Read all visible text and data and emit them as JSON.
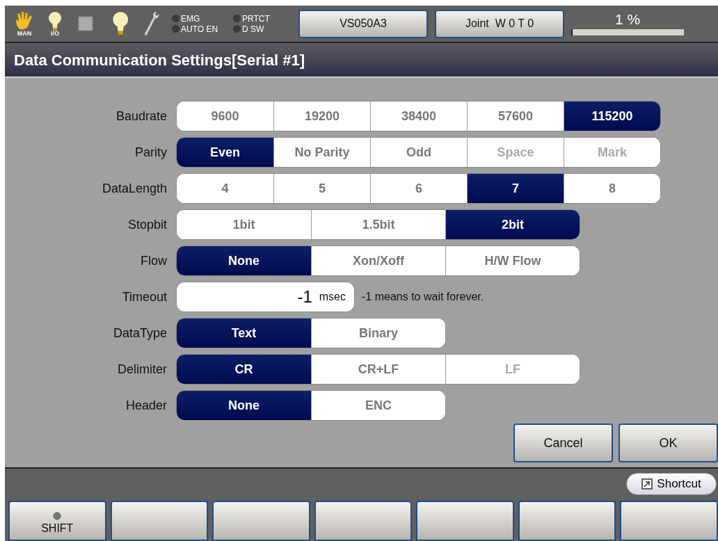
{
  "top_bar": {
    "mode_label": "MAN",
    "io_label": "I/O",
    "indicators": [
      {
        "label": "EMG",
        "on": false
      },
      {
        "label": "PRTCT",
        "on": false
      },
      {
        "label": "AUTO EN",
        "on": false
      },
      {
        "label": "D SW",
        "on": false
      }
    ],
    "buttons": [
      "VS050A3",
      "Joint  W 0 T 0"
    ],
    "speed": {
      "reading": "1 %",
      "level": 0.01
    }
  },
  "title": "Data Communication Settings[Serial #1]",
  "settings": [
    {
      "label": "Baudrate",
      "kind": "segments",
      "options": [
        {
          "label": "9600",
          "selected": false,
          "disabled": false
        },
        {
          "label": "19200",
          "selected": false,
          "disabled": false
        },
        {
          "label": "38400",
          "selected": false,
          "disabled": false
        },
        {
          "label": "57600",
          "selected": false,
          "disabled": false
        },
        {
          "label": "115200",
          "selected": true,
          "disabled": false
        }
      ]
    },
    {
      "label": "Parity",
      "kind": "segments",
      "options": [
        {
          "label": "Even",
          "selected": true,
          "disabled": false
        },
        {
          "label": "No Parity",
          "selected": false,
          "disabled": false
        },
        {
          "label": "Odd",
          "selected": false,
          "disabled": false
        },
        {
          "label": "Space",
          "selected": false,
          "disabled": true
        },
        {
          "label": "Mark",
          "selected": false,
          "disabled": true
        }
      ]
    },
    {
      "label": "DataLength",
      "kind": "segments",
      "options": [
        {
          "label": "4",
          "selected": false,
          "disabled": false
        },
        {
          "label": "5",
          "selected": false,
          "disabled": false
        },
        {
          "label": "6",
          "selected": false,
          "disabled": false
        },
        {
          "label": "7",
          "selected": true,
          "disabled": false
        },
        {
          "label": "8",
          "selected": false,
          "disabled": false
        }
      ]
    },
    {
      "label": "Stopbit",
      "kind": "segments",
      "options": [
        {
          "label": "1bit",
          "selected": false,
          "disabled": false
        },
        {
          "label": "1.5bit",
          "selected": false,
          "disabled": false
        },
        {
          "label": "2bit",
          "selected": true,
          "disabled": false
        }
      ]
    },
    {
      "label": "Flow",
      "kind": "segments",
      "options": [
        {
          "label": "None",
          "selected": true,
          "disabled": false
        },
        {
          "label": "Xon/Xoff",
          "selected": false,
          "disabled": false
        },
        {
          "label": "H/W Flow",
          "selected": false,
          "disabled": false
        }
      ]
    },
    {
      "label": "Timeout",
      "kind": "input",
      "value": "-1",
      "unit": "msec",
      "note": "-1 means to wait forever."
    },
    {
      "label": "DataType",
      "kind": "segments",
      "options": [
        {
          "label": "Text",
          "selected": true,
          "disabled": false
        },
        {
          "label": "Binary",
          "selected": false,
          "disabled": false
        }
      ]
    },
    {
      "label": "Delimiter",
      "kind": "segments",
      "options": [
        {
          "label": "CR",
          "selected": true,
          "disabled": false
        },
        {
          "label": "CR+LF",
          "selected": false,
          "disabled": false
        },
        {
          "label": "LF",
          "selected": false,
          "disabled": true
        }
      ]
    },
    {
      "label": "Header",
      "kind": "segments",
      "options": [
        {
          "label": "None",
          "selected": true,
          "disabled": false
        },
        {
          "label": "ENC",
          "selected": false,
          "disabled": false
        }
      ]
    }
  ],
  "dialog_buttons": [
    "Cancel",
    "OK"
  ],
  "shortcut": "Shortcut",
  "function_keys": [
    {
      "kind": "shift",
      "label": "SHIFT"
    },
    {
      "kind": "blank"
    },
    {
      "kind": "blank"
    },
    {
      "kind": "blank"
    },
    {
      "kind": "blank"
    },
    {
      "kind": "blank"
    },
    {
      "kind": "blank"
    }
  ]
}
